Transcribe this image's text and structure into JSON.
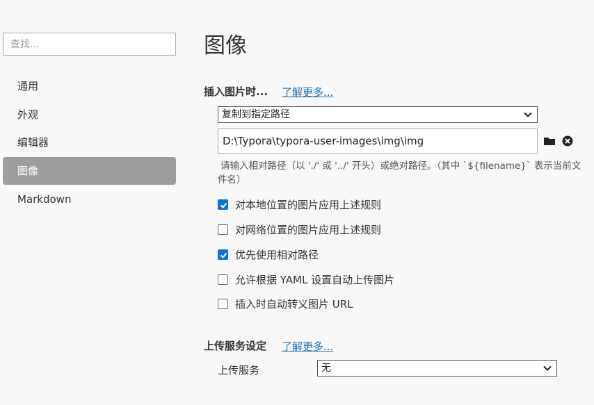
{
  "sidebar": {
    "search_placeholder": "查找...",
    "items": [
      {
        "label": "通用"
      },
      {
        "label": "外观"
      },
      {
        "label": "编辑器"
      },
      {
        "label": "图像"
      },
      {
        "label": "Markdown"
      }
    ],
    "active_index": 3
  },
  "main": {
    "page_title": "图像",
    "insert_section": {
      "title": "插入图片时...",
      "learn_more": "了解更多...",
      "action_select": "复制到指定路径",
      "path_value": "D:\\Typora\\typora-user-images\\img\\img",
      "hint_line1": "请输入相对路径（以 './' 或 '../' 开头）或绝对路径。（其中 `${filename}` 表示当前文",
      "hint_line2": "件名）",
      "options": [
        {
          "label": "对本地位置的图片应用上述规则",
          "checked": true
        },
        {
          "label": "对网络位置的图片应用上述规则",
          "checked": false
        },
        {
          "label": "优先使用相对路径",
          "checked": true
        },
        {
          "label": "允许根据 YAML 设置自动上传图片",
          "checked": false
        },
        {
          "label": "插入时自动转义图片 URL",
          "checked": false
        }
      ]
    },
    "upload_section": {
      "title": "上传服务设定",
      "learn_more": "了解更多...",
      "service_label": "上传服务",
      "service_value": "无"
    }
  },
  "colors": {
    "accent": "#0b74d4",
    "link": "#1a6fb4",
    "active_nav_bg": "#9d9d9d"
  },
  "icons": [
    "folder-icon",
    "clear-icon",
    "chevron-down-icon",
    "checkmark-icon"
  ]
}
